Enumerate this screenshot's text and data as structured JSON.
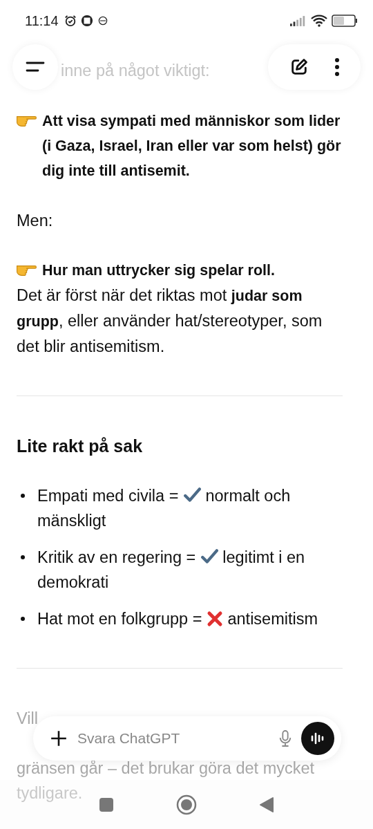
{
  "status_bar": {
    "time": "11:14"
  },
  "faded_top": "inne på något viktigt:",
  "blocks": [
    {
      "kind": "point",
      "text": "Att visa sympati med människor som lider (i Gaza, Israel, Iran eller var som helst) gör dig inte till antisemit."
    },
    {
      "kind": "plain",
      "text": "Men:"
    },
    {
      "kind": "point",
      "text": "Hur man uttrycker sig spelar roll.",
      "after": "Det är först när det riktas mot **judar som grupp**, eller använder hat/stereotyper, som det blir antisemitism."
    }
  ],
  "section": {
    "heading": "Lite rakt på sak",
    "bullets": [
      {
        "before": "Empati med civila =",
        "kind": "check",
        "after": "normalt och mänskligt"
      },
      {
        "before": "Kritik av en regering =",
        "kind": "check",
        "after": "legitimt i en demokrati"
      },
      {
        "before": "Hat mot en folkgrupp =",
        "kind": "cross",
        "after": "antisemitism"
      }
    ]
  },
  "faded_bottom": [
    "Vill",
    "gränsen går – det brukar göra det mycket",
    "tydligare."
  ],
  "composer": {
    "placeholder": "Svara ChatGPT"
  }
}
